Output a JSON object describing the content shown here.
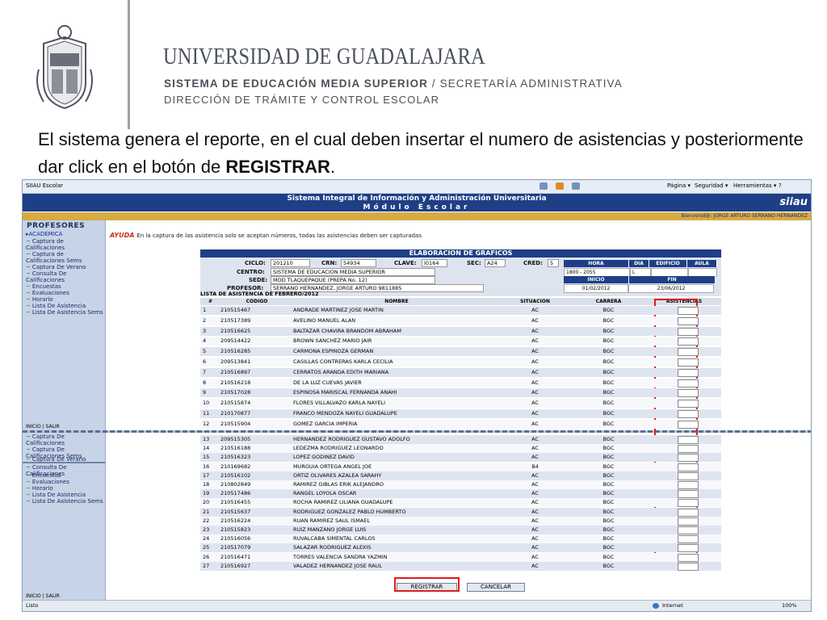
{
  "slide": {
    "university": "UNIVERSIDAD DE GUADALAJARA",
    "subtitle_1a": "SISTEMA DE EDUCACIÓN MEDIA SUPERIOR",
    "subtitle_1b": " / SECRETARÍA ADMINISTRATIVA",
    "subtitle_2": "DIRECCIÓN DE TRÁMITE Y CONTROL ESCOLAR",
    "caption_main": "El sistema genera el reporte, en el cual deben insertar el numero de asistencias y posteriormente dar click en el botón de ",
    "caption_bold": "REGISTRAR",
    "caption_end": ".",
    "crest_text": "UNIVERSIDAD DE GUADALAJARA"
  },
  "browser": {
    "tab_title": "SIIAU Escolar",
    "menu": [
      "Página ▾",
      "Seguridad ▾",
      "Herramientas ▾",
      "?"
    ],
    "status_left": "Listo",
    "status_zone": "Internet",
    "zoom": "100%"
  },
  "app": {
    "header_line1": "Sistema Integral de Información y Administración Universitaria",
    "header_line2": "Módulo Escolar",
    "logo": "siiau",
    "welcome": "Bienvenid@: JORGE ARTURO SERRANO HERNANDEZ"
  },
  "sidebar": {
    "title": "PROFESORES",
    "items": [
      "▸ACADEMICA",
      "Captura de Calificaciones",
      "Captura de Calificaciones Sems",
      "Captura De Verano",
      "Consulta De Calificaciones",
      "Encuestas",
      "Evaluaciones",
      "Horario",
      "Lista De Asistencia",
      "Lista De Asistencia Sems"
    ],
    "footer": "INICIO | SALIR",
    "items2": [
      "Captura De Calificaciones",
      "Captura De Calificaciones Sems",
      "Captura De Verano",
      "Consulta De Calificaciones",
      "Encuestas",
      "Evaluaciones",
      "Horario",
      "Lista De Asistencia",
      "Lista De Asistencia Sems"
    ],
    "footer2": "INICIO | SALIR"
  },
  "help": {
    "label": "AYUDA",
    "text": "En la captura de las asistencia solo se aceptan números, todas las asistencias deben ser capturadas"
  },
  "form": {
    "title": "ELABORACION DE GRAFICOS",
    "ciclo_label": "CICLO:",
    "ciclo": "201210",
    "crn_label": "CRN:",
    "crn": "54934",
    "clave_label": "CLAVE:",
    "clave": "I0164",
    "sec_label": "SEC:",
    "sec": "A24",
    "cred_label": "CRED:",
    "cred": "5",
    "centro_label": "CENTRO:",
    "centro": "SISTEMA DE EDUCACION MEDIA SUPERIOR",
    "sede_label": "SEDE:",
    "sede": "MOD TLAQUEPAQUE (PREPA No. 12)",
    "profesor_label": "PROFESOR:",
    "profesor": "SERRANO HERNANDEZ, JORGE ARTURO 9811885",
    "sched_head": [
      "HORA",
      "DIA",
      "EDIFICIO",
      "AULA"
    ],
    "sched_vals": [
      "1800 - 2055",
      "L",
      "",
      ""
    ],
    "period_head": [
      "INICIO",
      "FIN"
    ],
    "period_vals": [
      "01/02/2012",
      "23/06/2012"
    ]
  },
  "list": {
    "title": "LISTA DE ASISTENCIA DE FEBRERO/2012",
    "columns": [
      "#",
      "CODIGO",
      "NOMBRE",
      "SITUACION",
      "CARRERA",
      "ASISTENCIAS"
    ],
    "rows_top": [
      [
        "1",
        "210515467",
        "ANDRADE MARTINEZ JOSE MARTIN",
        "AC",
        "BGC"
      ],
      [
        "2",
        "210517389",
        "AVELINO MANUEL ALAN",
        "AC",
        "BGC"
      ],
      [
        "3",
        "210516625",
        "BALTAZAR CHAVIRA BRANDOM ABRAHAM",
        "AC",
        "BGC"
      ],
      [
        "4",
        "209514422",
        "BROWN SANCHEZ MARIO JAIR",
        "AC",
        "BGC"
      ],
      [
        "5",
        "210516285",
        "CARMONA ESPINOZA GERMAN",
        "AC",
        "BGC"
      ],
      [
        "6",
        "209513841",
        "CASILLAS CONTRERAS KARLA CECILIA",
        "AC",
        "BGC"
      ],
      [
        "7",
        "210516897",
        "CERRATOS ARANDA EDITH MARIANA",
        "AC",
        "BGC"
      ],
      [
        "8",
        "210516218",
        "DE LA LUZ CUEVAS JAVIER",
        "AC",
        "BGC"
      ],
      [
        "9",
        "210517028",
        "ESPINOSA MARISCAL FERNANDA ANAHI",
        "AC",
        "BGC"
      ],
      [
        "10",
        "210515874",
        "FLORES VILLALVAZO KARLA NAYELI",
        "AC",
        "BGC"
      ],
      [
        "11",
        "210170877",
        "FRANCO MENDOZA NAYELI GUADALUPE",
        "AC",
        "BGC"
      ],
      [
        "12",
        "210515904",
        "GOMEZ GARCIA IMPERIA",
        "AC",
        "BGC"
      ]
    ],
    "rows_bottom": [
      [
        "13",
        "209515305",
        "HERNANDEZ RODRIGUEZ GUSTAVO ADOLFO",
        "AC",
        "BGC"
      ],
      [
        "14",
        "210516188",
        "LEDEZMA RODRIGUEZ LEONARDO",
        "AC",
        "BGC"
      ],
      [
        "15",
        "210516323",
        "LOPEZ GODINEZ DAVID",
        "AC",
        "BGC"
      ],
      [
        "16",
        "210169682",
        "MURGUIA ORTEGA ANGEL JOE",
        "B4",
        "BGC"
      ],
      [
        "17",
        "210516102",
        "ORTIZ OLIVARES AZALEA SARAHY",
        "AC",
        "BGC"
      ],
      [
        "18",
        "210802849",
        "RAMIREZ GIBLAS ERIK ALEJANDRO",
        "AC",
        "BGC"
      ],
      [
        "19",
        "210517486",
        "RANGEL LOYOLA OSCAR",
        "AC",
        "BGC"
      ],
      [
        "20",
        "210516455",
        "ROCHA RAMIREZ LILIANA GUADALUPE",
        "AC",
        "BGC"
      ],
      [
        "21",
        "210515637",
        "RODRIGUEZ GONZALEZ PABLO HUMBERTO",
        "AC",
        "BGC"
      ],
      [
        "22",
        "210516224",
        "RUAN RAMIREZ SAUL ISMAEL",
        "AC",
        "BGC"
      ],
      [
        "23",
        "210515823",
        "RUIZ MANZANO JORGE LUIS",
        "AC",
        "BGC"
      ],
      [
        "24",
        "210516056",
        "RUVALCABA SIMENTAL CARLOS",
        "AC",
        "BGC"
      ],
      [
        "25",
        "210517079",
        "SALAZAR RODRIGUEZ ALEXIS",
        "AC",
        "BGC"
      ],
      [
        "26",
        "210516471",
        "TORRES VALENCIA SANDRA YAZMIN",
        "AC",
        "BGC"
      ],
      [
        "27",
        "210516927",
        "VALADEZ HERNANDEZ JOSE RAUL",
        "AC",
        "BGC"
      ]
    ]
  },
  "buttons": {
    "register": "REGISTRAR",
    "cancel": "CANCELAR"
  },
  "colors": {
    "highlight": "#e21b1b",
    "header_blue": "#1e3f86",
    "gold_bar": "#d5ac43"
  }
}
